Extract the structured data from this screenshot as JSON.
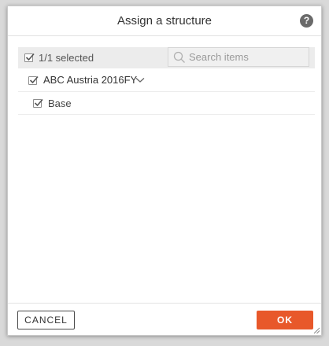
{
  "dialog": {
    "title": "Assign a structure",
    "help_label": "?"
  },
  "toolbar": {
    "selected_text": "1/1 selected",
    "search_placeholder": "Search items",
    "search_value": ""
  },
  "tree": {
    "items": [
      {
        "label": "ABC Austria 2016FY",
        "checked": true,
        "expandable": true
      },
      {
        "label": "Base",
        "checked": true,
        "expandable": false
      }
    ]
  },
  "footer": {
    "cancel_label": "CANCEL",
    "ok_label": "OK"
  },
  "colors": {
    "primary_button": "#e8582a",
    "toolbar_bg": "#ececec"
  }
}
